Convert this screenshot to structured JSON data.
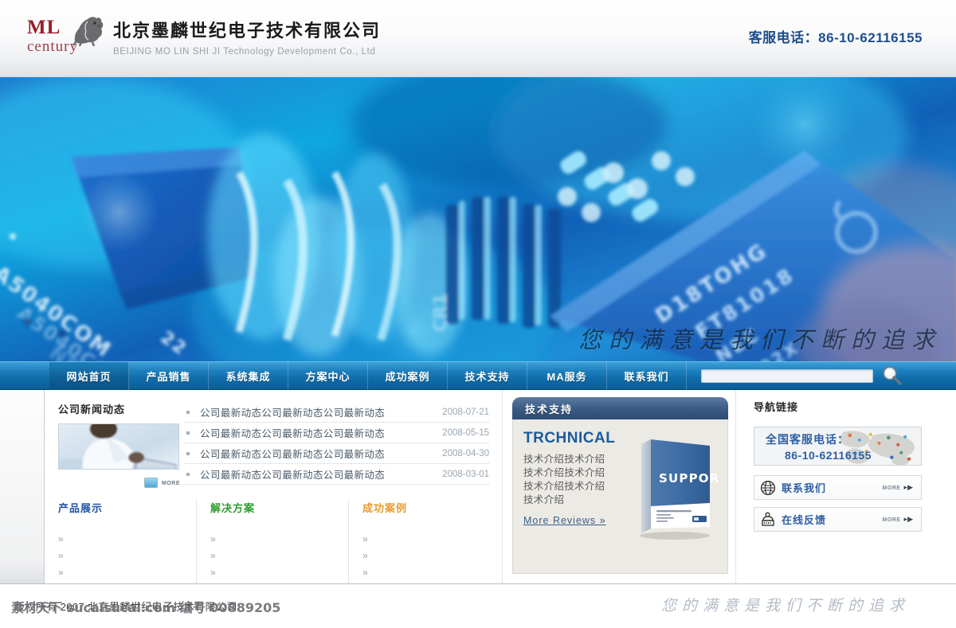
{
  "header": {
    "logo": {
      "line1": "ML",
      "line2": "century",
      "icon": "lion-statue-icon"
    },
    "company_cn": "北京墨麟世纪电子技术有限公司",
    "company_en": "BEIJING MO LIN SHI JI Technology Development Co., Ltd",
    "phone_label": "客服电话：86-10-62116155"
  },
  "banner": {
    "slogan": "您的满意是我们不断的追求",
    "image_alt": "blue circuit board macro photograph"
  },
  "nav": {
    "items": [
      {
        "label": "网站首页",
        "active": true
      },
      {
        "label": "产品销售",
        "active": false
      },
      {
        "label": "系统集成",
        "active": false
      },
      {
        "label": "方案中心",
        "active": false
      },
      {
        "label": "成功案例",
        "active": false
      },
      {
        "label": "技术支持",
        "active": false
      },
      {
        "label": "MA服务",
        "active": false
      },
      {
        "label": "联系我们",
        "active": false
      }
    ],
    "search": {
      "value": "",
      "placeholder": ""
    }
  },
  "news": {
    "heading": "公司新闻动态",
    "more_label": "more",
    "items": [
      {
        "title": "公司最新动态公司最新动态公司最新动态",
        "date": "2008-07-21"
      },
      {
        "title": "公司最新动态公司最新动态公司最新动态",
        "date": "2008-05-15"
      },
      {
        "title": "公司最新动态公司最新动态公司最新动态",
        "date": "2008-04-30"
      },
      {
        "title": "公司最新动态公司最新动态公司最新动态",
        "date": "2008-03-01"
      }
    ]
  },
  "columns": [
    {
      "title": "产品展示",
      "color": "#2255a8",
      "links": [
        "",
        "",
        ""
      ]
    },
    {
      "title": "解决方案",
      "color": "#2d9b2d",
      "links": [
        "",
        "",
        ""
      ]
    },
    {
      "title": "成功案例",
      "color": "#e89b2a",
      "links": [
        "",
        "",
        ""
      ]
    }
  ],
  "tech": {
    "bar_title": "技术支持",
    "brand": "TRCHNICAL",
    "lines": [
      "技术介绍技术介绍",
      "技术介绍技术介绍",
      "技术介绍技术介绍",
      "技术介绍"
    ],
    "more_label": "More Reviews »",
    "box_title": "SUPPORT"
  },
  "sidebar": {
    "heading": "导航链接",
    "phone_box": {
      "line1": "全国客服电话：",
      "line2": "86-10-62116155"
    },
    "buttons": [
      {
        "label": "联系我们",
        "more": "more",
        "icon": "globe-icon"
      },
      {
        "label": "在线反馈",
        "more": "more",
        "icon": "mailbox-icon"
      }
    ]
  },
  "footer": {
    "copyright": "版权所有 2007 北京墨麟世纪电子技术有限公司",
    "slogan": "您的满意是我们不断的追求",
    "watermark": "素材天下 sucaisucai.com 编号 00889205"
  },
  "colors": {
    "nav_blue": "#0e6ba8",
    "accent_blue": "#1f4e8c",
    "brand_red": "#9b1d28",
    "green": "#2d9b2d",
    "orange": "#e89b2a"
  }
}
